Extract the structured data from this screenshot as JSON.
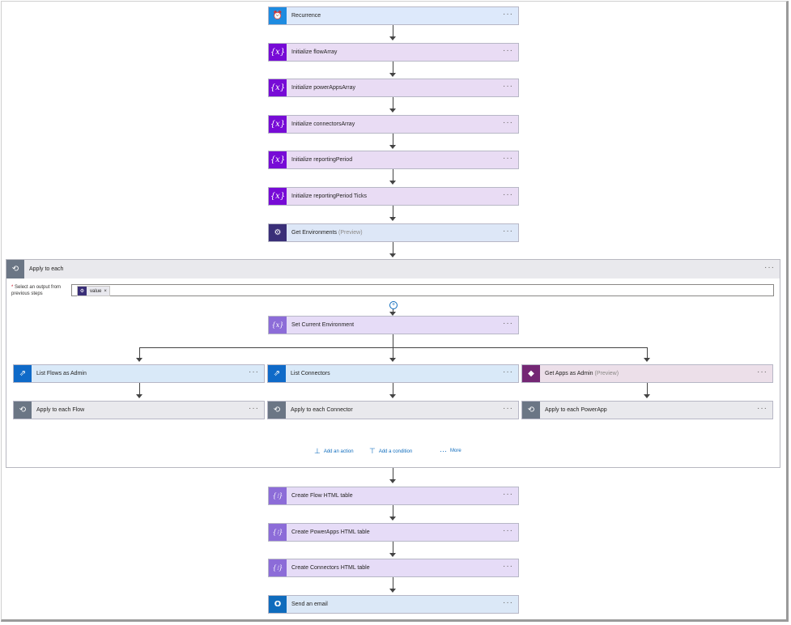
{
  "actions": {
    "recurrence": {
      "label": "Recurrence",
      "icon": "alarm-clock-icon"
    },
    "init_flow": {
      "label": "Initialize flowArray",
      "icon": "variable-icon"
    },
    "init_powerapps": {
      "label": "Initialize powerAppsArray",
      "icon": "variable-icon"
    },
    "init_connectors": {
      "label": "Initialize connectorsArray",
      "icon": "variable-icon"
    },
    "init_period": {
      "label": "Initialize reportingPeriod",
      "icon": "variable-icon"
    },
    "init_ticks": {
      "label": "Initialize reportingPeriod Ticks",
      "icon": "variable-icon"
    },
    "get_env": {
      "label": "Get Environments",
      "preview": "(Preview)",
      "icon": "environment-icon"
    }
  },
  "glyphs": {
    "var": "{x}",
    "data": "{⁝}",
    "clock": "⏰",
    "loop": "⟲",
    "flow": "⇗",
    "apps": "◆",
    "mail": "O",
    "env": "⚙",
    "dots": "···"
  },
  "scope": {
    "title": "Apply to each",
    "select_label_req": "*",
    "select_label": "Select an output from previous steps",
    "token_value": "value",
    "token_remove": "×",
    "set_env": {
      "label": "Set Current Environment"
    },
    "branches": [
      {
        "action": "List Flows as Admin",
        "loop": "Apply to each Flow"
      },
      {
        "action": "List Connectors",
        "loop": "Apply to each Connector"
      },
      {
        "action": "Get Apps as Admin",
        "preview": "(Preview)",
        "loop": "Apply to each PowerApp"
      }
    ],
    "footer": {
      "add_action": "Add an action",
      "add_condition": "Add a condition",
      "more": "More"
    }
  },
  "after": {
    "flow_table": {
      "label": "Create Flow HTML table"
    },
    "powerapps_table": {
      "label": "Create PowerApps HTML table"
    },
    "connectors_table": {
      "label": "Create Connectors HTML table"
    },
    "email": {
      "label": "Send an email"
    }
  }
}
